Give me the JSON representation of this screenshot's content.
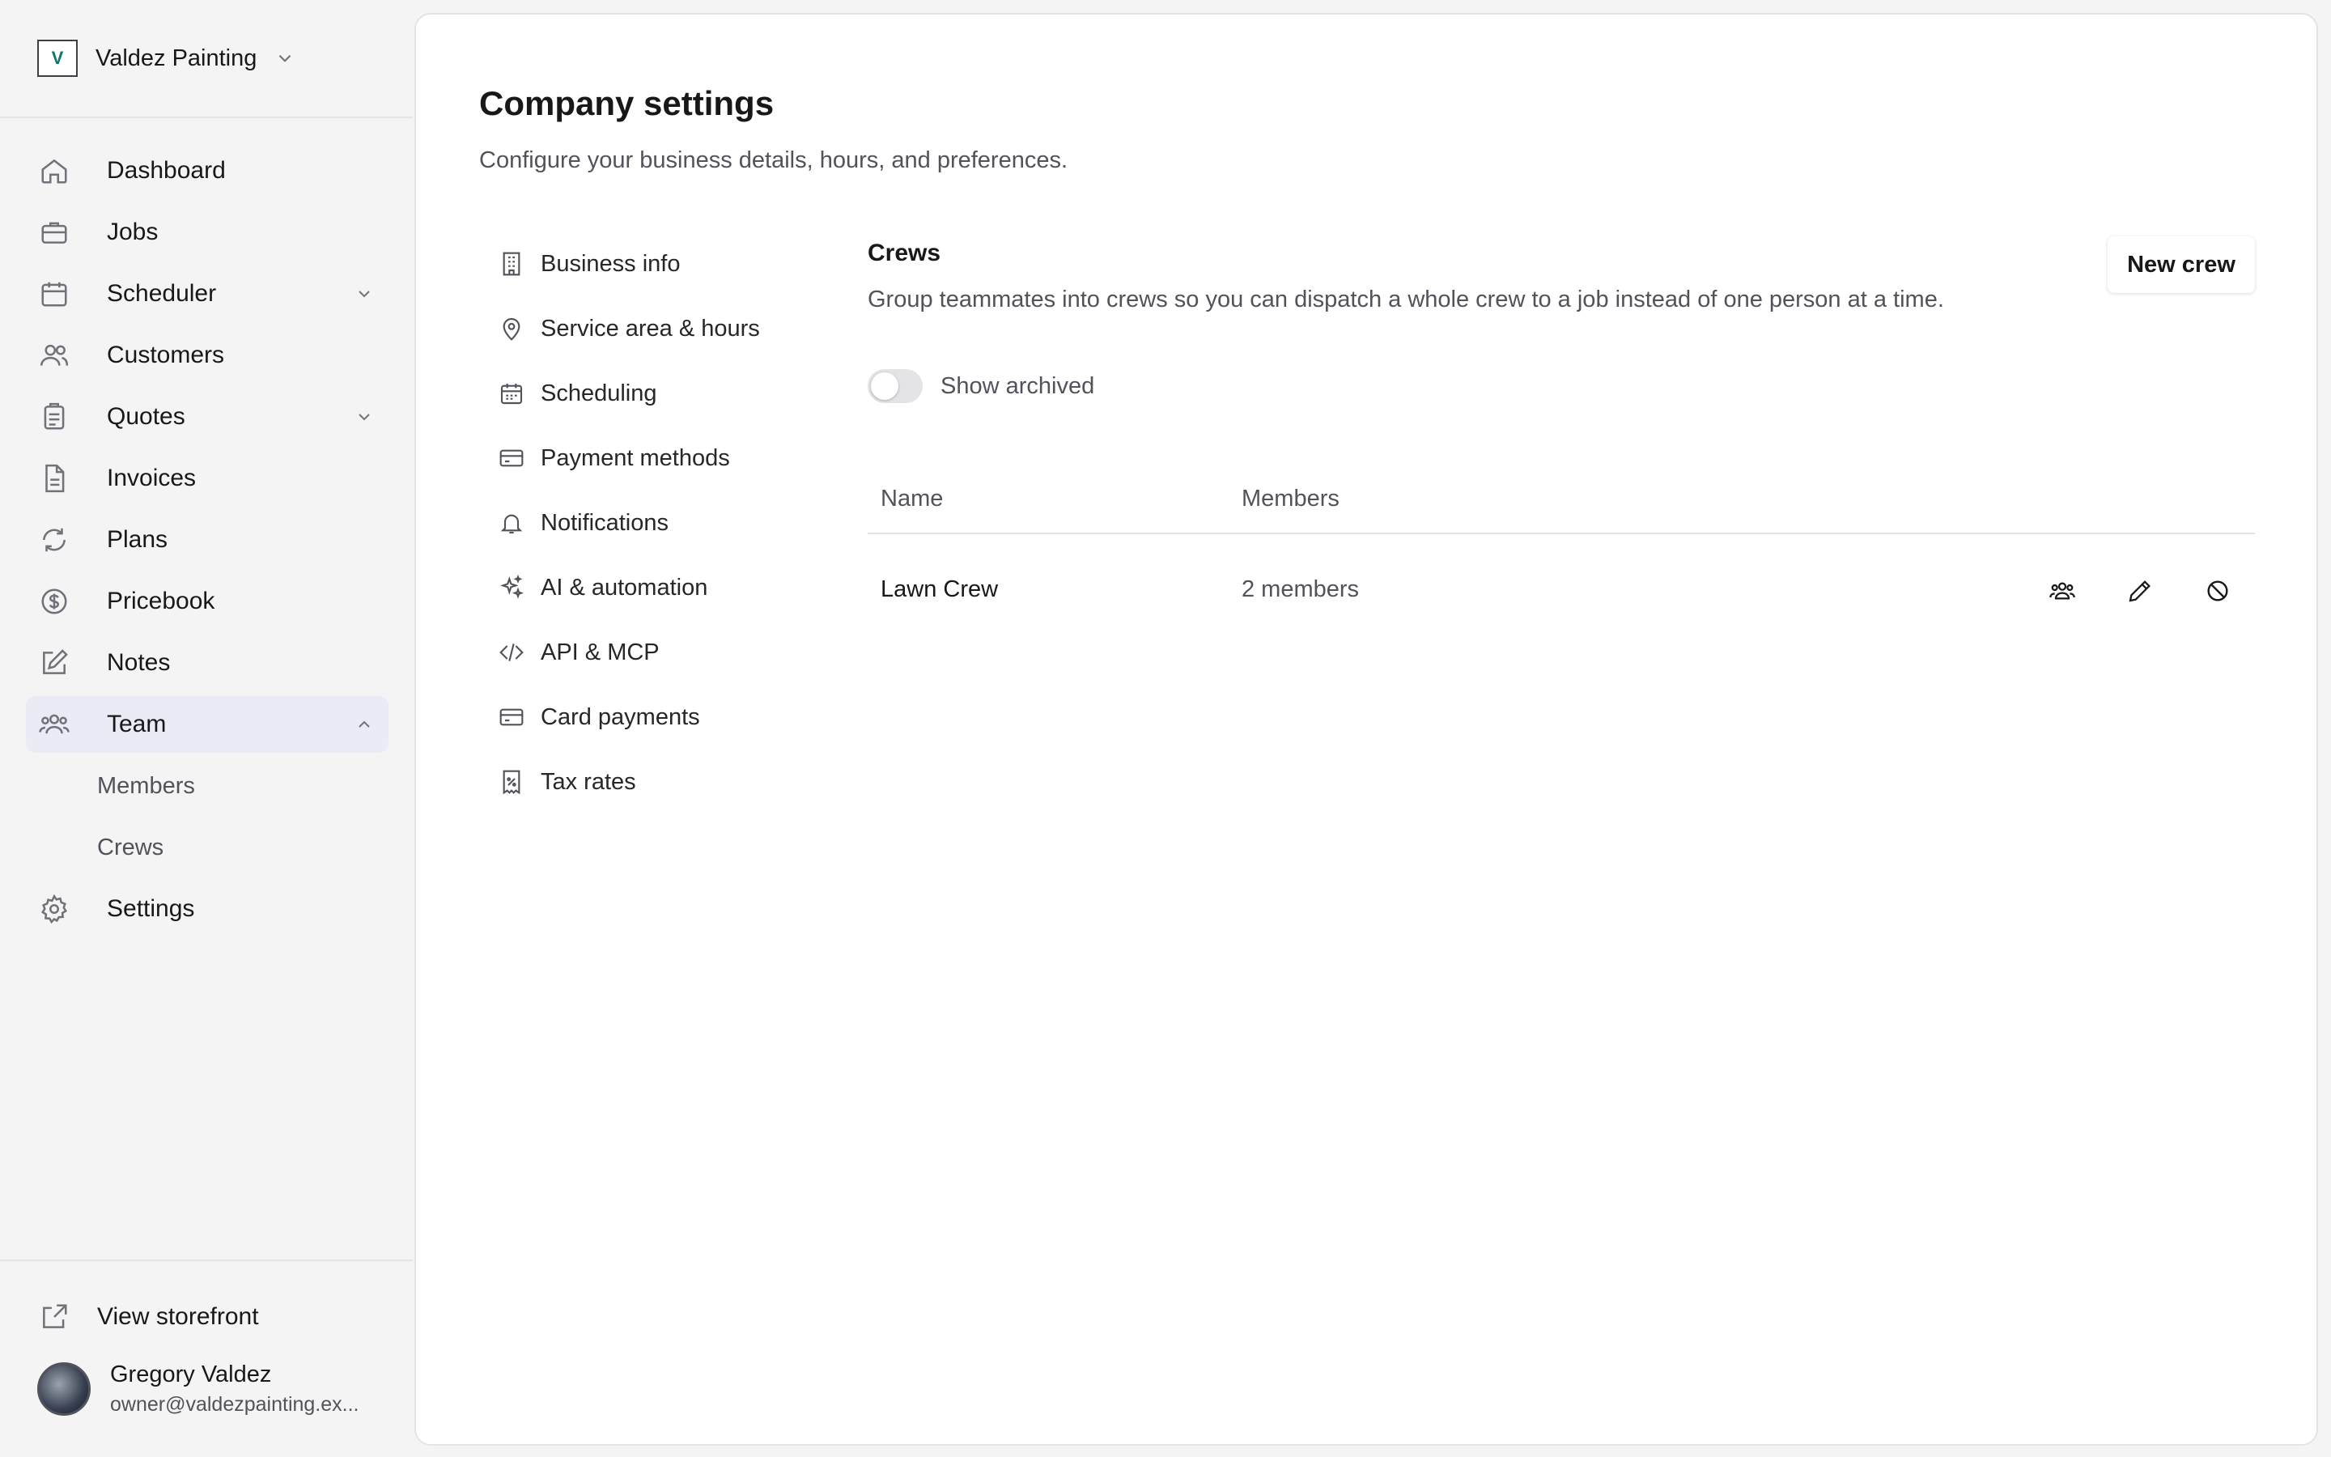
{
  "brand": {
    "name": "Valdez Painting",
    "logo_text": "V"
  },
  "nav": {
    "items": [
      {
        "label": "Dashboard"
      },
      {
        "label": "Jobs"
      },
      {
        "label": "Scheduler"
      },
      {
        "label": "Customers"
      },
      {
        "label": "Quotes"
      },
      {
        "label": "Invoices"
      },
      {
        "label": "Plans"
      },
      {
        "label": "Pricebook"
      },
      {
        "label": "Notes"
      },
      {
        "label": "Team"
      },
      {
        "label": "Settings"
      }
    ],
    "team_sub": [
      {
        "label": "Members"
      },
      {
        "label": "Crews"
      }
    ]
  },
  "footer": {
    "storefront_label": "View storefront",
    "user_name": "Gregory Valdez",
    "user_email": "owner@valdezpainting.ex..."
  },
  "page": {
    "title": "Company settings",
    "subtitle": "Configure your business details, hours, and preferences."
  },
  "settings_nav": [
    {
      "label": "Business info"
    },
    {
      "label": "Service area & hours"
    },
    {
      "label": "Scheduling"
    },
    {
      "label": "Payment methods"
    },
    {
      "label": "Notifications"
    },
    {
      "label": "AI & automation"
    },
    {
      "label": "API & MCP"
    },
    {
      "label": "Card payments"
    },
    {
      "label": "Tax rates"
    }
  ],
  "crews": {
    "title": "Crews",
    "description": "Group teammates into crews so you can dispatch a whole crew to a job instead of one person at a time.",
    "new_button": "New crew",
    "toggle_label": "Show archived",
    "toggle_on": false,
    "columns": [
      "Name",
      "Members"
    ],
    "rows": [
      {
        "name": "Lawn Crew",
        "members": "2 members"
      }
    ]
  }
}
